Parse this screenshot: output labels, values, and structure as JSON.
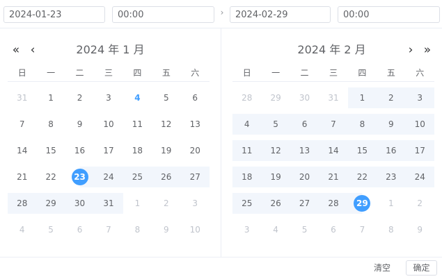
{
  "header": {
    "start_date": "2024-01-23",
    "start_time": "00:00",
    "end_date": "2024-02-29",
    "end_time": "00:00",
    "separator": "›"
  },
  "nav": {
    "prev_year": "«",
    "prev_month": "‹",
    "next_month": "›",
    "next_year": "»"
  },
  "weekdays": [
    "日",
    "一",
    "二",
    "三",
    "四",
    "五",
    "六"
  ],
  "left_panel": {
    "title": "2024 年 1 月",
    "weeks": [
      [
        {
          "d": "31",
          "t": "o"
        },
        {
          "d": "1"
        },
        {
          "d": "2"
        },
        {
          "d": "3"
        },
        {
          "d": "4",
          "t": "today"
        },
        {
          "d": "5"
        },
        {
          "d": "6"
        }
      ],
      [
        {
          "d": "7"
        },
        {
          "d": "8"
        },
        {
          "d": "9"
        },
        {
          "d": "10"
        },
        {
          "d": "11"
        },
        {
          "d": "12"
        },
        {
          "d": "13"
        }
      ],
      [
        {
          "d": "14"
        },
        {
          "d": "15"
        },
        {
          "d": "16"
        },
        {
          "d": "17"
        },
        {
          "d": "18"
        },
        {
          "d": "19"
        },
        {
          "d": "20"
        }
      ],
      [
        {
          "d": "21"
        },
        {
          "d": "22"
        },
        {
          "d": "23",
          "t": "start"
        },
        {
          "d": "24",
          "t": "r"
        },
        {
          "d": "25",
          "t": "r"
        },
        {
          "d": "26",
          "t": "r"
        },
        {
          "d": "27",
          "t": "r"
        }
      ],
      [
        {
          "d": "28",
          "t": "r"
        },
        {
          "d": "29",
          "t": "r"
        },
        {
          "d": "30",
          "t": "r"
        },
        {
          "d": "31",
          "t": "r"
        },
        {
          "d": "1",
          "t": "o"
        },
        {
          "d": "2",
          "t": "o"
        },
        {
          "d": "3",
          "t": "o"
        }
      ],
      [
        {
          "d": "4",
          "t": "o"
        },
        {
          "d": "5",
          "t": "o"
        },
        {
          "d": "6",
          "t": "o"
        },
        {
          "d": "7",
          "t": "o"
        },
        {
          "d": "8",
          "t": "o"
        },
        {
          "d": "9",
          "t": "o"
        },
        {
          "d": "10",
          "t": "o"
        }
      ]
    ]
  },
  "right_panel": {
    "title": "2024 年 2 月",
    "weeks": [
      [
        {
          "d": "28",
          "t": "o"
        },
        {
          "d": "29",
          "t": "o"
        },
        {
          "d": "30",
          "t": "o"
        },
        {
          "d": "31",
          "t": "o"
        },
        {
          "d": "1",
          "t": "r"
        },
        {
          "d": "2",
          "t": "r"
        },
        {
          "d": "3",
          "t": "r"
        }
      ],
      [
        {
          "d": "4",
          "t": "r"
        },
        {
          "d": "5",
          "t": "r"
        },
        {
          "d": "6",
          "t": "r"
        },
        {
          "d": "7",
          "t": "r"
        },
        {
          "d": "8",
          "t": "r"
        },
        {
          "d": "9",
          "t": "r"
        },
        {
          "d": "10",
          "t": "r"
        }
      ],
      [
        {
          "d": "11",
          "t": "r"
        },
        {
          "d": "12",
          "t": "r"
        },
        {
          "d": "13",
          "t": "r"
        },
        {
          "d": "14",
          "t": "r"
        },
        {
          "d": "15",
          "t": "r"
        },
        {
          "d": "16",
          "t": "r"
        },
        {
          "d": "17",
          "t": "r"
        }
      ],
      [
        {
          "d": "18",
          "t": "r"
        },
        {
          "d": "19",
          "t": "r"
        },
        {
          "d": "20",
          "t": "r"
        },
        {
          "d": "21",
          "t": "r"
        },
        {
          "d": "22",
          "t": "r"
        },
        {
          "d": "23",
          "t": "r"
        },
        {
          "d": "24",
          "t": "r"
        }
      ],
      [
        {
          "d": "25",
          "t": "r"
        },
        {
          "d": "26",
          "t": "r"
        },
        {
          "d": "27",
          "t": "r"
        },
        {
          "d": "28",
          "t": "r"
        },
        {
          "d": "29",
          "t": "end"
        },
        {
          "d": "1",
          "t": "o"
        },
        {
          "d": "2",
          "t": "o"
        }
      ],
      [
        {
          "d": "3",
          "t": "o"
        },
        {
          "d": "4",
          "t": "o"
        },
        {
          "d": "5",
          "t": "o"
        },
        {
          "d": "6",
          "t": "o"
        },
        {
          "d": "7",
          "t": "o"
        },
        {
          "d": "8",
          "t": "o"
        },
        {
          "d": "9",
          "t": "o"
        }
      ]
    ]
  },
  "footer": {
    "clear_label": "清空",
    "confirm_label": "确定"
  },
  "colors": {
    "accent": "#409eff",
    "range_bg": "#f2f6fc",
    "muted_text": "#c0c4cc",
    "text": "#606266",
    "border": "#dcdfe6"
  }
}
